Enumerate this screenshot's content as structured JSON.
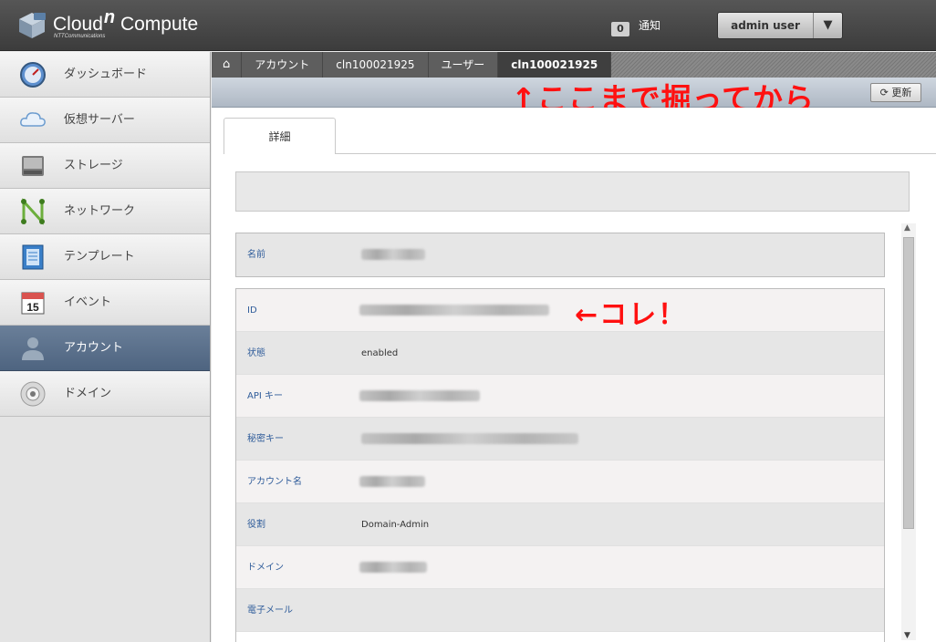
{
  "header": {
    "brand": "Cloud",
    "brand_n": "n",
    "product": "Compute",
    "subtitle": "NTTCommunications",
    "notifications_count": "0",
    "notifications_label": "通知",
    "user_name": "admin user",
    "user_menu_icon": "triangle-down"
  },
  "sidebar": {
    "items": [
      {
        "label": "ダッシュボード",
        "icon": "gauge-icon"
      },
      {
        "label": "仮想サーバー",
        "icon": "cloud-icon"
      },
      {
        "label": "ストレージ",
        "icon": "disk-icon"
      },
      {
        "label": "ネットワーク",
        "icon": "network-icon"
      },
      {
        "label": "テンプレート",
        "icon": "template-icon"
      },
      {
        "label": "イベント",
        "icon": "calendar-icon",
        "calendar_day": "15"
      },
      {
        "label": "アカウント",
        "icon": "person-icon"
      },
      {
        "label": "ドメイン",
        "icon": "globe-icon"
      }
    ],
    "active_index": 6
  },
  "breadcrumb": {
    "home_icon": "home-icon",
    "items": [
      "アカウント",
      "cln100021925",
      "ユーザー",
      "cln100021925"
    ]
  },
  "toolbar": {
    "refresh_label": "更新"
  },
  "annotations": {
    "top": "↑ここまで掘ってから",
    "id": "←コレ！"
  },
  "tab": {
    "label": "詳細"
  },
  "details": {
    "name_label": "名前",
    "rows": [
      {
        "label": "ID",
        "value": ""
      },
      {
        "label": "状態",
        "value": "enabled"
      },
      {
        "label": "API キー",
        "value": ""
      },
      {
        "label": "秘密キー",
        "value": ""
      },
      {
        "label": "アカウント名",
        "value": ""
      },
      {
        "label": "役割",
        "value": "Domain-Admin"
      },
      {
        "label": "ドメイン",
        "value": ""
      },
      {
        "label": "電子メール",
        "value": ""
      }
    ]
  },
  "colors": {
    "header": "#4a4a4a",
    "active_nav": "#5a6f8b",
    "annotation": "#ff1010",
    "label_text": "#2f5c9a"
  }
}
